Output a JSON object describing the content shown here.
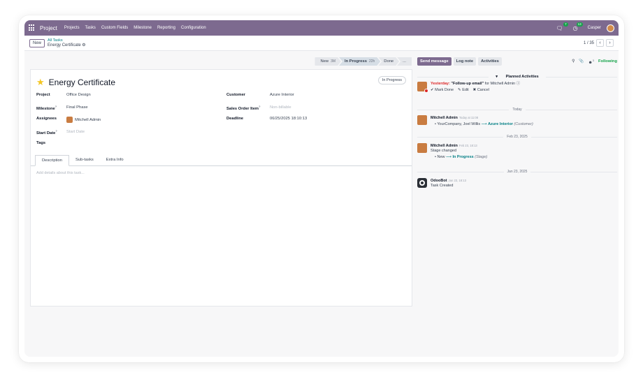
{
  "nav": {
    "app_name": "Project",
    "menu": [
      "Projects",
      "Tasks",
      "Custom Fields",
      "Milestone",
      "Reporting",
      "Configuration"
    ],
    "messages_badge": "7",
    "activities_badge": "13",
    "user": "Casper"
  },
  "control": {
    "new_label": "New",
    "breadcrumb_parent": "All Tasks",
    "breadcrumb_current": "Energy Certificate",
    "pager_value": "1 / 35"
  },
  "statusbar": {
    "stages": [
      {
        "label": "New",
        "count": "3M"
      },
      {
        "label": "In Progress",
        "count": "22h"
      },
      {
        "label": "Done",
        "count": ""
      },
      {
        "label": "...",
        "count": ""
      }
    ]
  },
  "task": {
    "title": "Energy Certificate",
    "state": "In Progress",
    "fields_left": [
      {
        "label": "Project",
        "value": "Office Design"
      },
      {
        "label": "Milestone",
        "value": "Final Phase",
        "help": "?"
      },
      {
        "label": "Assignees",
        "value": "Mitchell Admin"
      },
      {
        "label": "Start Date",
        "value": "Start Date",
        "help": "?"
      },
      {
        "label": "Tags",
        "value": ""
      }
    ],
    "fields_right": [
      {
        "label": "Customer",
        "value": "Azure Interior"
      },
      {
        "label": "Sales Order Item",
        "value": "Non-billable",
        "help": "?"
      },
      {
        "label": "Deadline",
        "value": "06/25/2025 18:10:13"
      }
    ],
    "tabs": [
      "Description",
      "Sub-tasks",
      "Extra Info"
    ],
    "description_placeholder": "Add details about this task..."
  },
  "chatter": {
    "send_message": "Send message",
    "log_note": "Log note",
    "activities": "Activities",
    "attachments_count": "",
    "followers_count": "3",
    "following": "Following",
    "planned_header": "Planned Activities",
    "activity": {
      "when": "Yesterday:",
      "summary": "\"Follow-up email\"",
      "for_text": "for Mitchell Admin",
      "mark_done": "Mark Done",
      "edit": "Edit",
      "cancel": "Cancel"
    },
    "dividers": [
      "Today",
      "Feb 23, 2025",
      "Jan 23, 2025"
    ],
    "messages": [
      {
        "author": "Mitchell Admin",
        "time": "Today at 11:08",
        "old": "YourCompany, Joel Willis",
        "new": "Azure Interior",
        "field": "(Customer)"
      },
      {
        "author": "Mitchell Admin",
        "time": "Feb 23, 18:13",
        "body": "Stage changed",
        "old": "New",
        "new": "In Progress",
        "field": "(Stage)"
      },
      {
        "author": "OdooBot",
        "time": "Jan 23, 18:13",
        "body": "Task Created"
      }
    ]
  }
}
